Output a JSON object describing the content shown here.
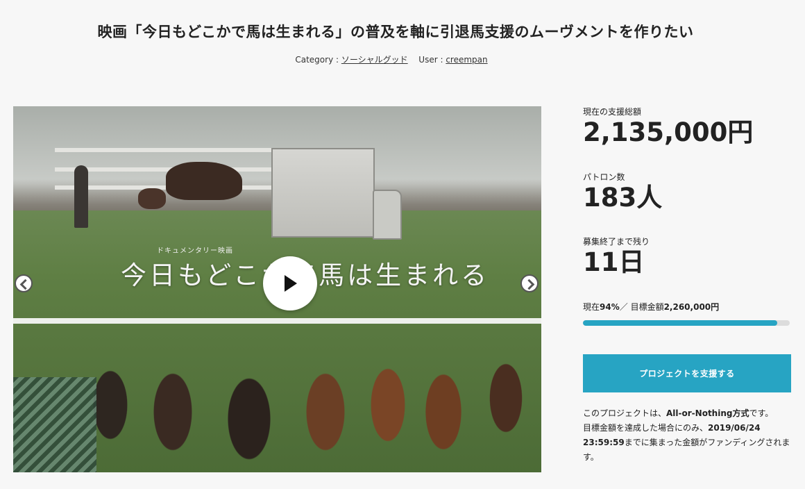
{
  "project": {
    "title": "映画「今日もどこかで馬は生まれる」の普及を軸に引退馬支援のムーヴメントを作りたい",
    "category_label": "Category :",
    "category_value": "ソーシャルグッド",
    "user_label": "User :",
    "user_value": "creempan"
  },
  "video": {
    "overlay_subtitle": "ドキュメンタリー映画",
    "overlay_title": "今日もどこかで馬は生まれる"
  },
  "stats": {
    "total_label": "現在の支援総額",
    "total_value": "2,135,000円",
    "patrons_label": "パトロン数",
    "patrons_value": "183人",
    "remaining_label": "募集終了まで残り",
    "remaining_value": "11日",
    "progress_prefix": "現在",
    "progress_percent_text": "94%",
    "progress_separator": "／ 目標金額",
    "goal_amount": "2,260,000円",
    "progress_fraction": 0.94
  },
  "actions": {
    "support_button": "プロジェクトを支援する"
  },
  "notice": {
    "line1_prefix": "このプロジェクトは、",
    "line1_bold": "All-or-Nothing方式",
    "line1_suffix": "です。",
    "line2_prefix": "目標金額を達成した場合にのみ、",
    "line2_bold": "2019/06/24 23:59:59",
    "line2_suffix": "までに集まった金額がファンディングされます。"
  },
  "colors": {
    "accent": "#27a4c3",
    "background": "#f7f7f7",
    "track": "#dcdcdc"
  },
  "icons": {
    "play": "play-icon",
    "prev": "chevron-left-icon",
    "next": "chevron-right-icon"
  }
}
